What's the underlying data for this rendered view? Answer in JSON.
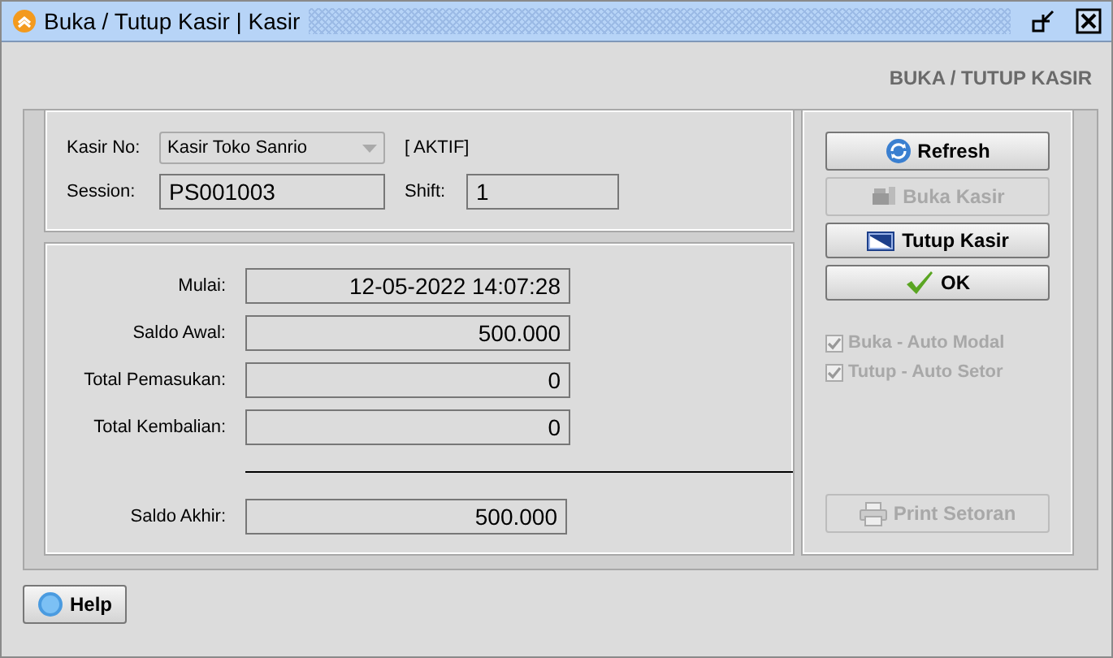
{
  "window": {
    "title": "Buka / Tutup Kasir | Kasir"
  },
  "heading": "BUKA / TUTUP KASIR",
  "kasir": {
    "label": "Kasir No:",
    "value": "Kasir Toko Sanrio",
    "status": "[ AKTIF]"
  },
  "session": {
    "label": "Session:",
    "value": "PS001003"
  },
  "shift": {
    "label": "Shift:",
    "value": "1"
  },
  "summary": [
    {
      "label": "Mulai:",
      "value": "12-05-2022 14:07:28"
    },
    {
      "label": "Saldo Awal:",
      "value": "500.000"
    },
    {
      "label": "Total Pemasukan:",
      "value": "0"
    },
    {
      "label": "Total Kembalian:",
      "value": "0"
    }
  ],
  "total": {
    "label": "Saldo Akhir:",
    "value": "500.000"
  },
  "actions": [
    {
      "label": "Refresh",
      "kind": "refresh",
      "disabled": false
    },
    {
      "label": "Buka Kasir",
      "kind": "open",
      "disabled": true
    },
    {
      "label": "Tutup Kasir",
      "kind": "close",
      "disabled": false
    },
    {
      "label": "OK",
      "kind": "ok",
      "disabled": false
    }
  ],
  "options": [
    {
      "label": "Buka - Auto Modal",
      "checked": true,
      "disabled": true
    },
    {
      "label": "Tutup - Auto Setor",
      "checked": true,
      "disabled": true
    }
  ],
  "print_button": {
    "label": "Print Setoran",
    "disabled": true
  },
  "help_button": {
    "label": "Help"
  }
}
